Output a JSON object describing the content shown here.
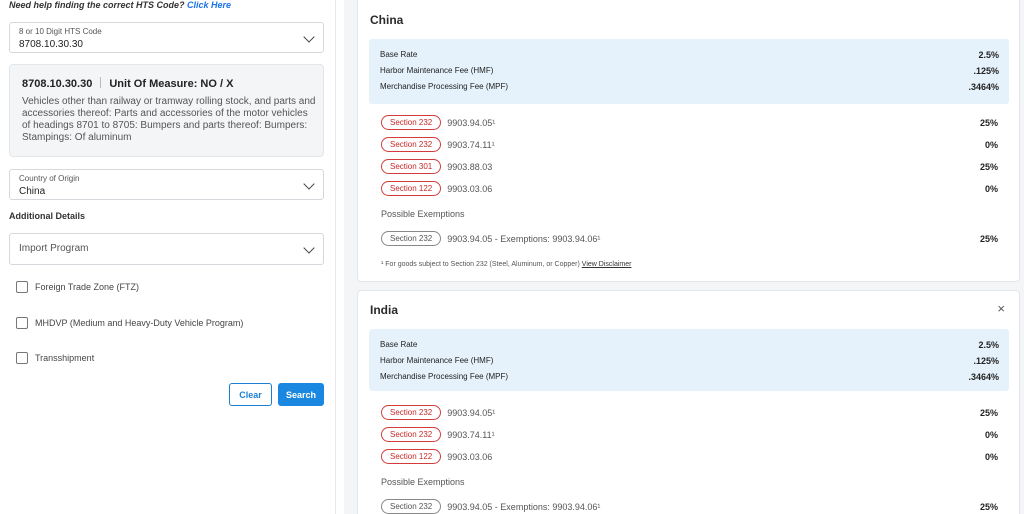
{
  "help": {
    "text": "Need help finding the correct HTS Code?",
    "link": "Click Here"
  },
  "hts_select": {
    "label": "8 or 10 Digit HTS Code",
    "value": "8708.10.30.30"
  },
  "hts_card": {
    "code": "8708.10.30.30",
    "unit": "Unit Of Measure: NO / X",
    "description": "Vehicles other than railway or tramway rolling stock, and parts and accessories thereof: Parts and accessories of the motor vehicles of headings 8701 to 8705: Bumpers and parts thereof: Bumpers: Stampings: Of aluminum"
  },
  "origin_select": {
    "label": "Country of Origin",
    "value": "China"
  },
  "additional_details": "Additional Details",
  "import_program": {
    "placeholder": "Import Program"
  },
  "checkboxes": [
    {
      "label": "Foreign Trade Zone (FTZ)"
    },
    {
      "label": "MHDVP (Medium and Heavy-Duty Vehicle Program)"
    },
    {
      "label": "Transshipment"
    }
  ],
  "buttons": {
    "clear": "Clear",
    "search": "Search"
  },
  "china": {
    "title": "China",
    "fees": [
      {
        "name": "Base Rate",
        "value": "2.5%"
      },
      {
        "name": "Harbor Maintenance Fee (HMF)",
        "value": ".125%"
      },
      {
        "name": "Merchandise Processing Fee (MPF)",
        "value": ".3464%"
      }
    ],
    "rates": [
      {
        "tag": "Section 232",
        "code": "9903.94.05¹",
        "pct": "25%"
      },
      {
        "tag": "Section 232",
        "code": "9903.74.11¹",
        "pct": "0%"
      },
      {
        "tag": "Section 301",
        "code": "9903.88.03",
        "pct": "25%"
      },
      {
        "tag": "Section 122",
        "code": "9903.03.06",
        "pct": "0%"
      }
    ],
    "exemptions_label": "Possible Exemptions",
    "exemption": {
      "tag": "Section 232",
      "code": "9903.94.05 - Exemptions: 9903.94.06¹",
      "pct": "25%"
    },
    "footnote": "¹ For goods subject to Section 232 (Steel, Aluminum, or Copper)",
    "footnote_link": "View Disclaimer"
  },
  "india": {
    "title": "India",
    "close": "×",
    "fees": [
      {
        "name": "Base Rate",
        "value": "2.5%"
      },
      {
        "name": "Harbor Maintenance Fee (HMF)",
        "value": ".125%"
      },
      {
        "name": "Merchandise Processing Fee (MPF)",
        "value": ".3464%"
      }
    ],
    "rates": [
      {
        "tag": "Section 232",
        "code": "9903.94.05¹",
        "pct": "25%"
      },
      {
        "tag": "Section 232",
        "code": "9903.74.11¹",
        "pct": "0%"
      },
      {
        "tag": "Section 122",
        "code": "9903.03.06",
        "pct": "0%"
      }
    ],
    "exemptions_label": "Possible Exemptions",
    "exemption": {
      "tag": "Section 232",
      "code": "9903.94.05 - Exemptions: 9903.94.06¹",
      "pct": "25%"
    }
  },
  "colors": {
    "accent": "#1a88e0",
    "fee_bg": "#e6f2fb",
    "section_red": "#c62828"
  },
  "icons": [
    "chevron-down-icon",
    "close-icon",
    "checkbox-icon"
  ]
}
